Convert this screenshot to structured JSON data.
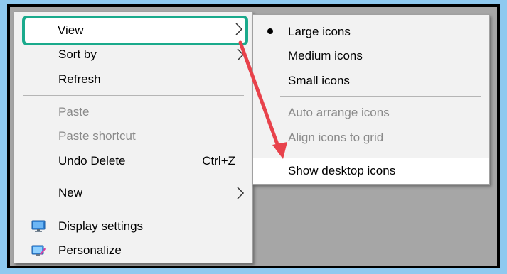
{
  "main_menu": {
    "view_label": "View",
    "sort_by_label": "Sort by",
    "refresh_label": "Refresh",
    "paste_label": "Paste",
    "paste_shortcut_label": "Paste shortcut",
    "undo_delete_label": "Undo Delete",
    "undo_delete_shortcut": "Ctrl+Z",
    "new_label": "New",
    "display_settings_label": "Display settings",
    "personalize_label": "Personalize"
  },
  "view_submenu": {
    "large_icons_label": "Large icons",
    "large_icons_selected": true,
    "medium_icons_label": "Medium icons",
    "small_icons_label": "Small icons",
    "auto_arrange_label": "Auto arrange icons",
    "align_to_grid_label": "Align icons to grid",
    "show_desktop_icons_label": "Show desktop icons"
  },
  "annotation": {
    "highlight_color": "#1aaa8c",
    "arrow_color": "#e8424b"
  },
  "icons": {
    "display_settings": "monitor-icon",
    "personalize": "personalize-icon",
    "submenu_arrow": "chevron-right-icon",
    "selected_marker": "bullet-icon"
  }
}
